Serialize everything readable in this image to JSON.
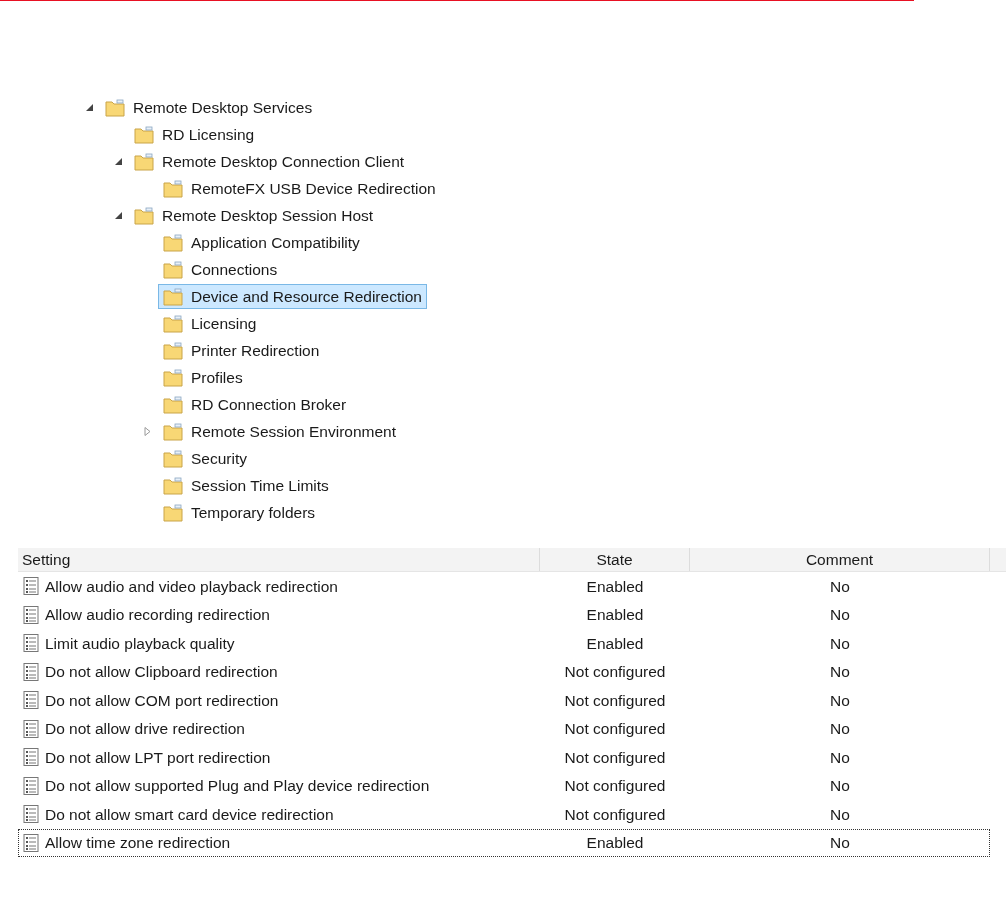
{
  "tree": [
    {
      "label": "Remote Desktop Services",
      "expanded": true,
      "selected": false,
      "children": [
        {
          "label": "RD Licensing",
          "selected": false
        },
        {
          "label": "Remote Desktop Connection Client",
          "expanded": true,
          "selected": false,
          "children": [
            {
              "label": "RemoteFX USB Device Redirection",
              "selected": false
            }
          ]
        },
        {
          "label": "Remote Desktop Session Host",
          "expanded": true,
          "selected": false,
          "children": [
            {
              "label": "Application Compatibility",
              "selected": false
            },
            {
              "label": "Connections",
              "selected": false
            },
            {
              "label": "Device and Resource Redirection",
              "selected": true
            },
            {
              "label": "Licensing",
              "selected": false
            },
            {
              "label": "Printer Redirection",
              "selected": false
            },
            {
              "label": "Profiles",
              "selected": false
            },
            {
              "label": "RD Connection Broker",
              "selected": false
            },
            {
              "label": "Remote Session Environment",
              "expanded": false,
              "selected": false
            },
            {
              "label": "Security",
              "selected": false
            },
            {
              "label": "Session Time Limits",
              "selected": false
            },
            {
              "label": "Temporary folders",
              "selected": false
            }
          ]
        }
      ]
    }
  ],
  "table": {
    "columns": [
      "Setting",
      "State",
      "Comment"
    ],
    "rows": [
      {
        "setting": "Allow audio and video playback redirection",
        "state": "Enabled",
        "comment": "No",
        "focused": false
      },
      {
        "setting": "Allow audio recording redirection",
        "state": "Enabled",
        "comment": "No",
        "focused": false
      },
      {
        "setting": "Limit audio playback quality",
        "state": "Enabled",
        "comment": "No",
        "focused": false
      },
      {
        "setting": "Do not allow Clipboard redirection",
        "state": "Not configured",
        "comment": "No",
        "focused": false
      },
      {
        "setting": "Do not allow COM port redirection",
        "state": "Not configured",
        "comment": "No",
        "focused": false
      },
      {
        "setting": "Do not allow drive redirection",
        "state": "Not configured",
        "comment": "No",
        "focused": false
      },
      {
        "setting": "Do not allow LPT port redirection",
        "state": "Not configured",
        "comment": "No",
        "focused": false
      },
      {
        "setting": "Do not allow supported Plug and Play device redirection",
        "state": "Not configured",
        "comment": "No",
        "focused": false
      },
      {
        "setting": "Do not allow smart card device redirection",
        "state": "Not configured",
        "comment": "No",
        "focused": false
      },
      {
        "setting": "Allow time zone redirection",
        "state": "Enabled",
        "comment": "No",
        "focused": true
      }
    ]
  }
}
